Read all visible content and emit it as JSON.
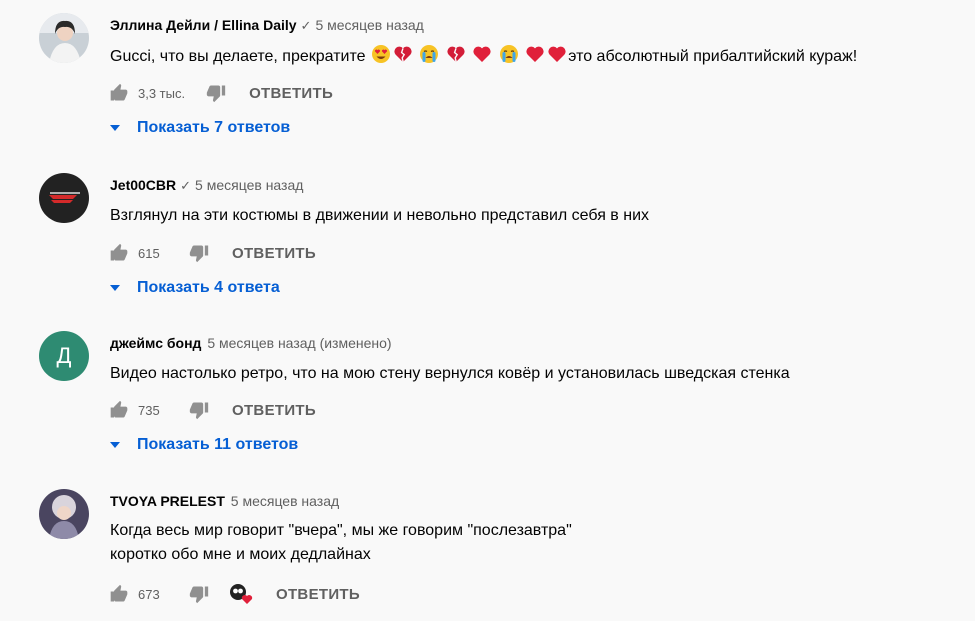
{
  "comments": [
    {
      "author": "Эллина Дейли / Ellina Daily",
      "verified": true,
      "time": "5 месяцев назад",
      "text_before": "Gucci, что вы делаете, прекратите",
      "emojis": [
        "heart-eyes",
        "broken-heart",
        "crying",
        "broken-heart",
        "heart",
        "crying",
        "heart",
        "heart"
      ],
      "text_after": "это абсолютный прибалтийский кураж!",
      "likes": "3,3 тыс.",
      "reply_label": "ОТВЕТИТЬ",
      "show_replies": "Показать 7 ответов"
    },
    {
      "author": "Jet00CBR",
      "verified": true,
      "time": "5 месяцев назад",
      "text": "Взглянул на эти костюмы в движении и невольно представил себя в них",
      "likes": "615",
      "reply_label": "ОТВЕТИТЬ",
      "show_replies": "Показать 4 ответа"
    },
    {
      "author": "джеймс бонд",
      "verified": false,
      "time": "5 месяцев назад (изменено)",
      "avatar_letter": "Д",
      "avatar_color": "#2e8b72",
      "text": "Видео настолько ретро, что на мою стену вернулся ковёр и установилась шведская стенка",
      "likes": "735",
      "reply_label": "ОТВЕТИТЬ",
      "show_replies": "Показать 11 ответов"
    },
    {
      "author": "TVOYA PRELEST",
      "verified": false,
      "time": "5 месяцев назад",
      "text_line1": "Когда весь мир говорит \"вчера\", мы же говорим \"послезавтра\"",
      "text_line2": "коротко обо мне и моих дедлайнах",
      "likes": "673",
      "creator_heart": true,
      "reply_label": "ОТВЕТИТЬ"
    }
  ],
  "colors": {
    "link": "#065fd4",
    "secondary": "#606060",
    "background": "#f9f9f9"
  }
}
